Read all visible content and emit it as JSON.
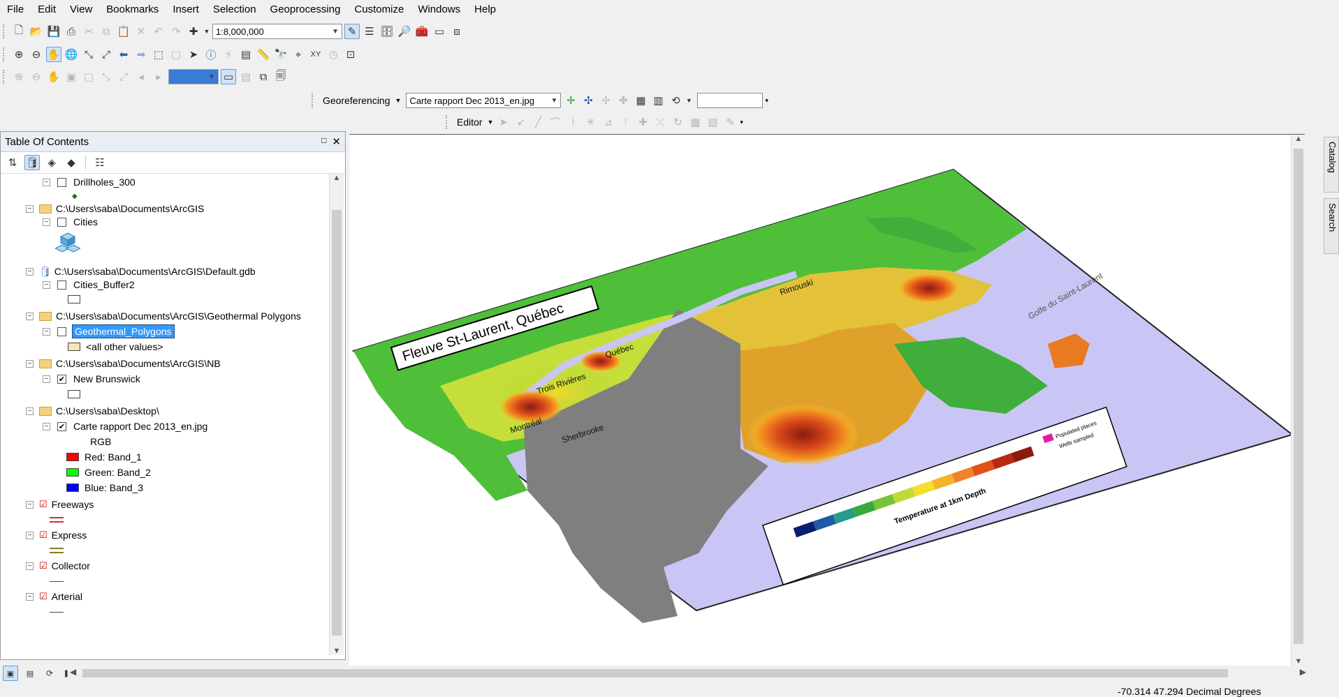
{
  "menu": [
    "File",
    "Edit",
    "View",
    "Bookmarks",
    "Insert",
    "Selection",
    "Geoprocessing",
    "Customize",
    "Windows",
    "Help"
  ],
  "toolbar": {
    "scale_value": "1:8,000,000"
  },
  "georef": {
    "label": "Georeferencing",
    "layer_value": "Carte rapport Dec 2013_en.jpg",
    "value_box": ""
  },
  "editor": {
    "label": "Editor"
  },
  "toc": {
    "title": "Table Of Contents",
    "items": [
      {
        "label": "Drillholes_300"
      },
      {
        "label": "C:\\Users\\saba\\Documents\\ArcGIS"
      },
      {
        "label": "Cities"
      },
      {
        "label": "C:\\Users\\saba\\Documents\\ArcGIS\\Default.gdb"
      },
      {
        "label": "Cities_Buffer2"
      },
      {
        "label": "C:\\Users\\saba\\Documents\\ArcGIS\\Geothermal Polygons"
      },
      {
        "label": "Geothermal_Polygons"
      },
      {
        "label": "<all other values>"
      },
      {
        "label": "C:\\Users\\saba\\Documents\\ArcGIS\\NB"
      },
      {
        "label": "New Brunswick"
      },
      {
        "label": "C:\\Users\\saba\\Desktop\\"
      },
      {
        "label": "Carte rapport Dec 2013_en.jpg"
      },
      {
        "label": "RGB"
      },
      {
        "label": "Red:    Band_1"
      },
      {
        "label": "Green:  Band_2"
      },
      {
        "label": "Blue:   Band_3"
      },
      {
        "label": "Freeways"
      },
      {
        "label": "Express"
      },
      {
        "label": "Collector"
      },
      {
        "label": "Arterial"
      }
    ]
  },
  "map": {
    "title_box": "Fleuve St-Laurent, Québec",
    "places": [
      "Rimouski",
      "Québec",
      "Trois Rivières",
      "Montréal",
      "Sherbrooke",
      "Golfe du Saint-Laurent"
    ],
    "legend_title": "Temperature at 1km Depth",
    "legend_items": [
      "Populated places",
      "Wells sampled"
    ]
  },
  "side_tabs": [
    "Catalog",
    "Search"
  ],
  "status": {
    "coords": "-70.314  47.294 Decimal Degrees"
  },
  "colors": {
    "selection": "#3399ff",
    "water": "#c9c6f5",
    "land_nodata": "#808080"
  }
}
